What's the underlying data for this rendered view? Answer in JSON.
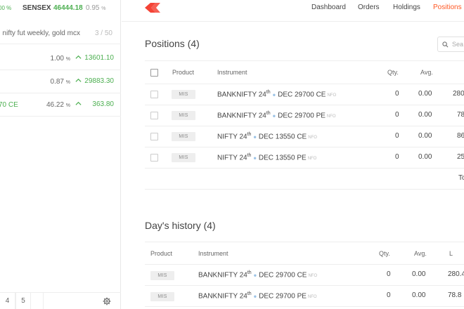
{
  "ticker": {
    "first_pct": "00 %",
    "name": "SENSEX",
    "value": "46444.18",
    "change": "0.95",
    "change_unit": "%"
  },
  "watchlist": {
    "search_query": ", nifty fut weekly, gold mcx",
    "count": "3 / 50",
    "items": [
      {
        "name": "",
        "pct": "1.00",
        "price": "13601.10"
      },
      {
        "name": "",
        "pct": "0.87",
        "price": "29883.30"
      },
      {
        "name": "70 CE",
        "pct": "46.22",
        "price": "363.80"
      }
    ],
    "pct_unit": "%",
    "pages": [
      "4",
      "5"
    ]
  },
  "header": {
    "nav": [
      {
        "label": "Dashboard",
        "active": false
      },
      {
        "label": "Orders",
        "active": false
      },
      {
        "label": "Holdings",
        "active": false
      },
      {
        "label": "Positions",
        "active": true
      }
    ]
  },
  "positions": {
    "title": "Positions (4)",
    "search_placeholder": "Sea",
    "columns": {
      "product": "Product",
      "instrument": "Instrument",
      "qty": "Qty.",
      "avg": "Avg."
    },
    "rows": [
      {
        "product": "MIS",
        "sym": "BANKNIFTY 24",
        "sup": "th",
        "rest": "DEC 29700 CE",
        "exchange": "NFO",
        "qty": "0",
        "avg": "0.00",
        "ltp": "280"
      },
      {
        "product": "MIS",
        "sym": "BANKNIFTY 24",
        "sup": "th",
        "rest": "DEC 29700 PE",
        "exchange": "NFO",
        "qty": "0",
        "avg": "0.00",
        "ltp": "78"
      },
      {
        "product": "MIS",
        "sym": "NIFTY 24",
        "sup": "th",
        "rest": "DEC 13550 CE",
        "exchange": "NFO",
        "qty": "0",
        "avg": "0.00",
        "ltp": "86"
      },
      {
        "product": "MIS",
        "sym": "NIFTY 24",
        "sup": "th",
        "rest": "DEC 13550 PE",
        "exchange": "NFO",
        "qty": "0",
        "avg": "0.00",
        "ltp": "25"
      }
    ],
    "total_label": "To"
  },
  "history": {
    "title": "Day's history (4)",
    "columns": {
      "product": "Product",
      "instrument": "Instrument",
      "qty": "Qty.",
      "avg": "Avg.",
      "ltp": "L"
    },
    "rows": [
      {
        "product": "MIS",
        "sym": "BANKNIFTY 24",
        "sup": "th",
        "rest": "DEC 29700 CE",
        "exchange": "NFO",
        "qty": "0",
        "avg": "0.00",
        "ltp": "280.4"
      },
      {
        "product": "MIS",
        "sym": "BANKNIFTY 24",
        "sup": "th",
        "rest": "DEC 29700 PE",
        "exchange": "NFO",
        "qty": "0",
        "avg": "0.00",
        "ltp": "78.8"
      }
    ]
  },
  "colors": {
    "accent": "#ff5722",
    "up": "#4caf50",
    "logo": "#f44336"
  }
}
